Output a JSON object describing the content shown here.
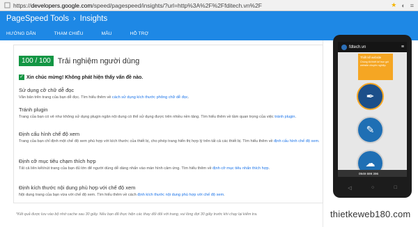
{
  "browser": {
    "url_prefix": "https://",
    "url_host": "developers.google.com",
    "url_path": "/speed/pagespeed/insights/?url=http%3A%2F%2Ffditech.vn%2F"
  },
  "header": {
    "product": "PageSpeed Tools",
    "separator": "›",
    "section": "Insights"
  },
  "nav": [
    "HƯỚNG DẪN",
    "THAM CHIẾU",
    "MẪU",
    "HỖ TRỢ"
  ],
  "result": {
    "score": "100 / 100",
    "title": "Trải nghiệm người dùng",
    "success": "Xin chúc mừng! Không phát hiện thấy vấn đề nào."
  },
  "rules": [
    {
      "heading": "Sử dụng cỡ chữ dễ đọc",
      "text": "Văn bản trên trang của bạn dễ đọc. Tìm hiểu thêm về ",
      "link": "cách sử dụng kích thước phông chữ dễ đọc",
      "after": "."
    },
    {
      "heading": "Tránh plugin",
      "text": "Trang của bạn có vẻ như không sử dụng plugin ngăn nội dung có thể sử dụng được trên nhiều nền tảng. Tìm hiểu thêm về tầm quan trọng của việc ",
      "link": "tránh plugin",
      "after": "."
    },
    {
      "heading": "Định cấu hình chế độ xem",
      "text": "Trang của bạn chỉ định một chế độ xem phù hợp với kích thước của thiết bị, cho phép trang hiển thị hợp lý trên tất cả các thiết bị. Tìm hiểu thêm về ",
      "link": "định cấu hình chế độ xem",
      "after": "."
    },
    {
      "heading": "Định cỡ mục tiêu chạm thích hợp",
      "text": "Tất cả liên kết/nút trang của bạn đủ lớn để người dùng dễ dàng nhấn vào màn hình cảm ứng. Tìm hiểu thêm về ",
      "link": "định cỡ mục tiêu nhấn thích hợp",
      "after": "."
    },
    {
      "heading": "Định kích thước nội dung phù hợp với chế độ xem",
      "text": "Nội dung trang của bạn vừa với chế độ xem. Tìm hiểu thêm về cách ",
      "link": "định kích thước nội dung phù hợp với chế độ xem",
      "after": "."
    }
  ],
  "footnote": "*Kết quả được lưu vào bộ nhớ cache sau 30 giây. Nếu bạn đã thực hiện các thay đổi đối với trang, vui lòng đợi 30 giây trước khi chạy lại kiểm tra.",
  "phone": {
    "site": "fdtech.vn",
    "popup_title": "Thiết kế website",
    "popup_text": "Chúng tôi thiết kế trọn gói website chuyên nghiệp",
    "hotline": "0949 699 396"
  },
  "watermark": "thietkeweb180.com",
  "colors": {
    "primary": "#1e88e5",
    "success": "#139644",
    "accent": "#f5a623"
  }
}
